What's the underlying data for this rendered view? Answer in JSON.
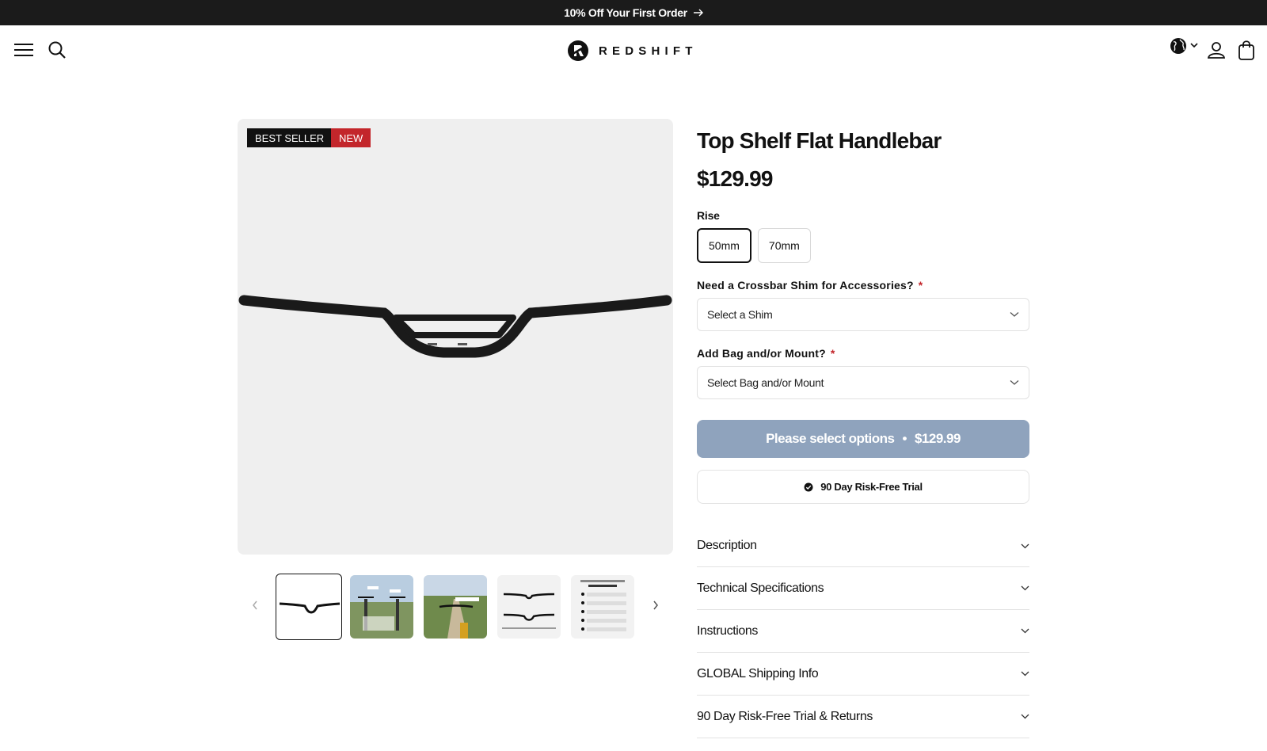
{
  "announcement": {
    "text": "10% Off Your First Order"
  },
  "brand": {
    "name": "REDSHIFT"
  },
  "badges": {
    "best_seller": "BEST SELLER",
    "new": "NEW"
  },
  "product": {
    "title": "Top Shelf Flat Handlebar",
    "price": "$129.99",
    "rise": {
      "label": "Rise",
      "options": [
        "50mm",
        "70mm"
      ],
      "selected": "50mm"
    },
    "shim": {
      "label": "Need a Crossbar Shim for Accessories?",
      "required_mark": "*",
      "value": "Select a Shim"
    },
    "bag": {
      "label": "Add Bag and/or Mount?",
      "required_mark": "*",
      "value": "Select Bag and/or Mount"
    },
    "cta": {
      "label": "Please select options",
      "separator": "•",
      "price": "$129.99"
    },
    "trial_badge": "90 Day Risk-Free Trial"
  },
  "accordion": [
    {
      "label": "Description"
    },
    {
      "label": "Technical Specifications"
    },
    {
      "label": "Instructions"
    },
    {
      "label": "GLOBAL Shipping Info"
    },
    {
      "label": "90 Day Risk-Free Trial & Returns"
    }
  ],
  "icons": {
    "menu": "hamburger-icon",
    "search": "search-icon",
    "region": "globe-icon",
    "account": "user-icon",
    "cart": "bag-icon"
  },
  "colors": {
    "announcement_bg": "#1b1b1b",
    "new_badge": "#c3262b",
    "cta_disabled": "#8fa3bd",
    "gallery_bg": "#efefef"
  }
}
